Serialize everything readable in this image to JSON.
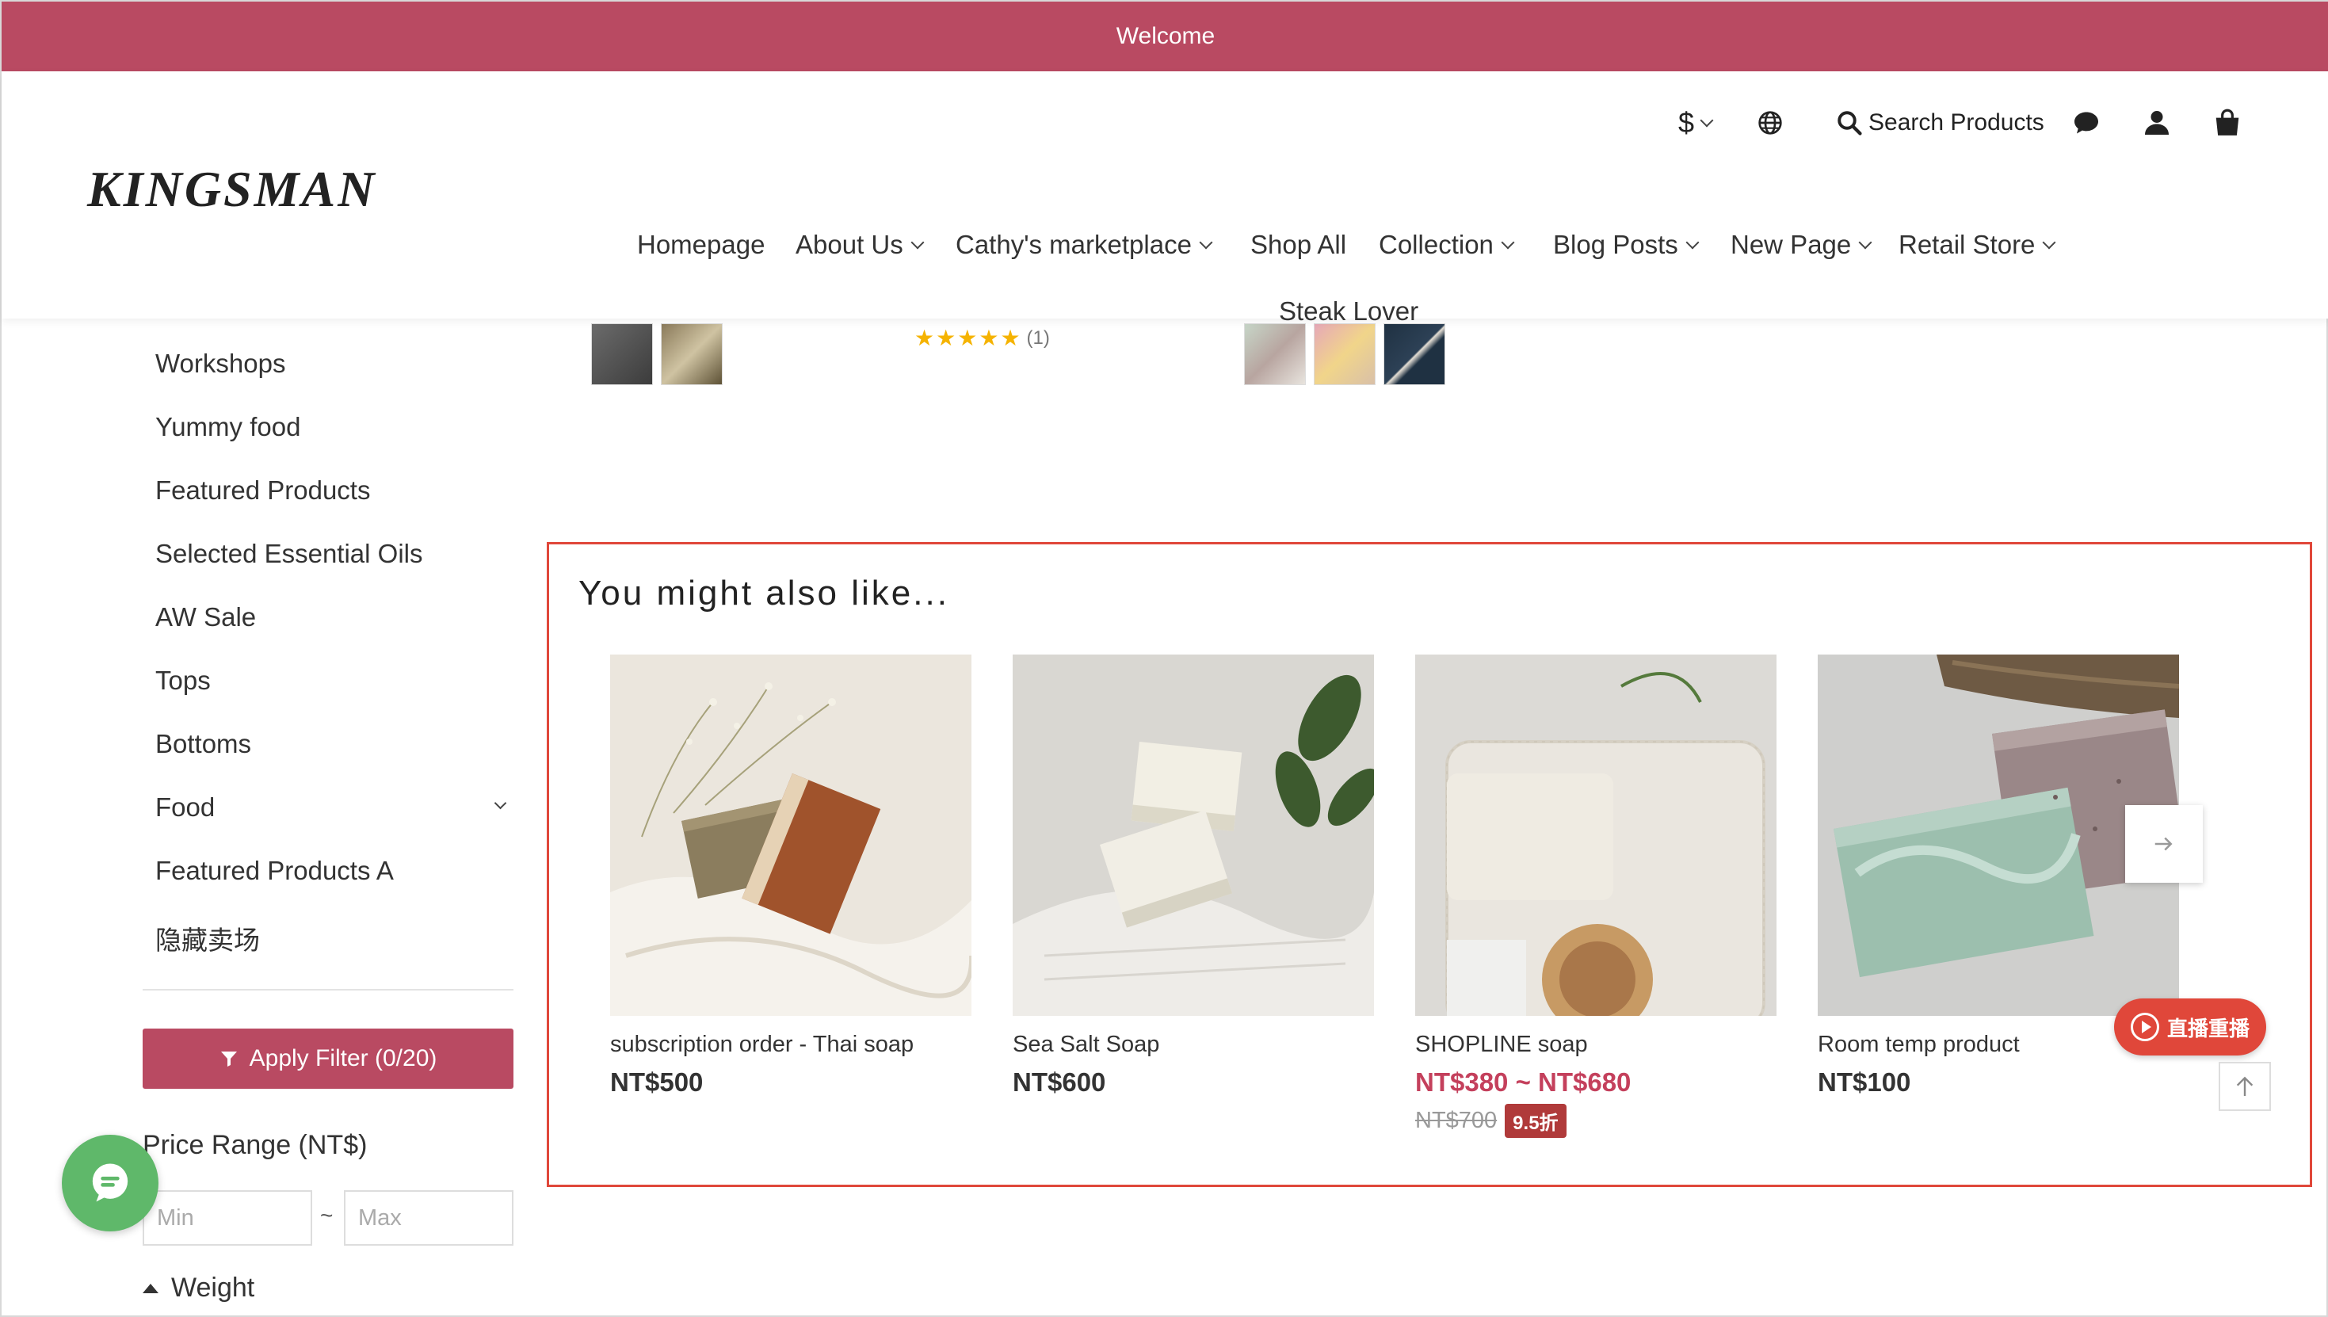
{
  "announcement": {
    "text": "Welcome"
  },
  "header": {
    "logo": "KINGSMAN",
    "currency": "$",
    "search_label": "Search Products"
  },
  "nav": {
    "items": [
      {
        "label": "Homepage"
      },
      {
        "label": "About Us"
      },
      {
        "label": "Cathy's marketplace"
      },
      {
        "label": "Shop All"
      },
      {
        "label": "Collection"
      },
      {
        "label": "Blog Posts"
      },
      {
        "label": "New Page"
      },
      {
        "label": "Retail Store"
      },
      {
        "label": "Steak Lover"
      }
    ]
  },
  "sidebar": {
    "categories": [
      {
        "label": "Workshops"
      },
      {
        "label": "Yummy food"
      },
      {
        "label": "Featured Products"
      },
      {
        "label": "Selected Essential Oils"
      },
      {
        "label": "AW Sale"
      },
      {
        "label": "Tops"
      },
      {
        "label": "Bottoms"
      },
      {
        "label": "Food"
      },
      {
        "label": "Featured Products A"
      },
      {
        "label": "隐藏卖场"
      }
    ],
    "apply_filter": "Apply Filter (0/20)",
    "price_range_title": "Price Range (NT$)",
    "min_placeholder": "Min",
    "max_placeholder": "Max",
    "tilde": "~",
    "weight_title": "Weight"
  },
  "above_row": {
    "rating_count": "(1)",
    "rating_stars": 5
  },
  "recommendations": {
    "title": "You might also like...",
    "products": [
      {
        "name": "subscription order - Thai soap",
        "price": "NT$500"
      },
      {
        "name": "Sea Salt Soap",
        "price": "NT$600"
      },
      {
        "name": "SHOPLINE soap",
        "price": "NT$380 ~ NT$680",
        "original_price": "NT$700",
        "discount": "9.5折"
      },
      {
        "name": "Room temp product",
        "price": "NT$100"
      }
    ]
  },
  "floating": {
    "live_replay": "直播重播"
  },
  "colors": {
    "brand": "#b94a62",
    "highlight_border": "#e0473a",
    "sale_price": "#c4405c",
    "chat_fab": "#5fb86a"
  }
}
